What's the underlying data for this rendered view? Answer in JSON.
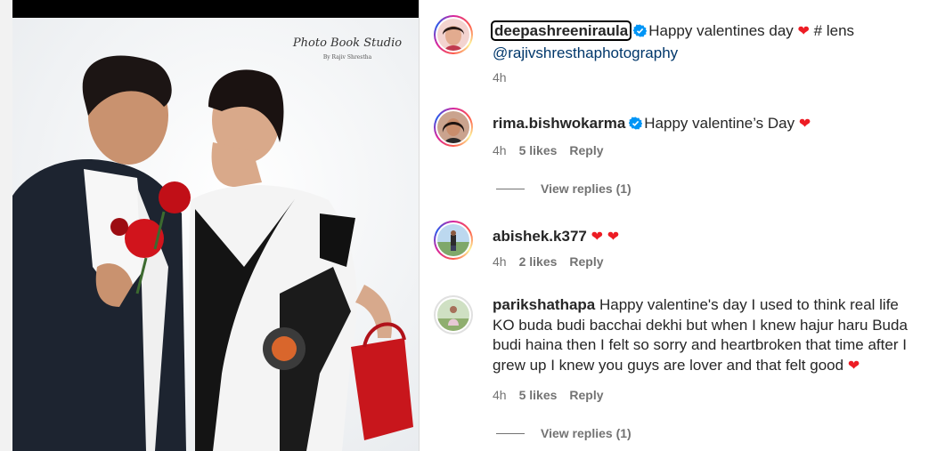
{
  "photo": {
    "watermark_line1": "Photo Book Studio",
    "watermark_line2": "By Rajiv Shrestha"
  },
  "colors": {
    "heart": "#ed1c24",
    "verified": "#0095f6",
    "link": "#00376b",
    "secondary_text": "#737373"
  },
  "caption": {
    "username": "deepashreeniraula",
    "verified": true,
    "text_before_mention": "Happy valentines day",
    "text_after_heart": "# lens",
    "mention": "@rajivshresthaphotography",
    "time": "4h"
  },
  "comments": [
    {
      "username": "rima.bishwokarma",
      "verified": true,
      "text": "Happy valentine’s Day",
      "hearts": 1,
      "time": "4h",
      "likes": "5 likes",
      "reply": "Reply",
      "view_replies": "View replies (1)"
    },
    {
      "username": "abishek.k377",
      "verified": false,
      "text": "",
      "hearts": 2,
      "time": "4h",
      "likes": "2 likes",
      "reply": "Reply"
    },
    {
      "username": "parikshathapa",
      "verified": false,
      "text": "Happy valentine's day I used to think real life KO buda budi bacchai dekhi but when I knew hajur haru Buda budi haina then I felt so sorry and heartbroken that time after I grew up I knew you guys are lover and that felt good",
      "hearts": 1,
      "time": "4h",
      "likes": "5 likes",
      "reply": "Reply",
      "view_replies": "View replies (1)"
    }
  ]
}
